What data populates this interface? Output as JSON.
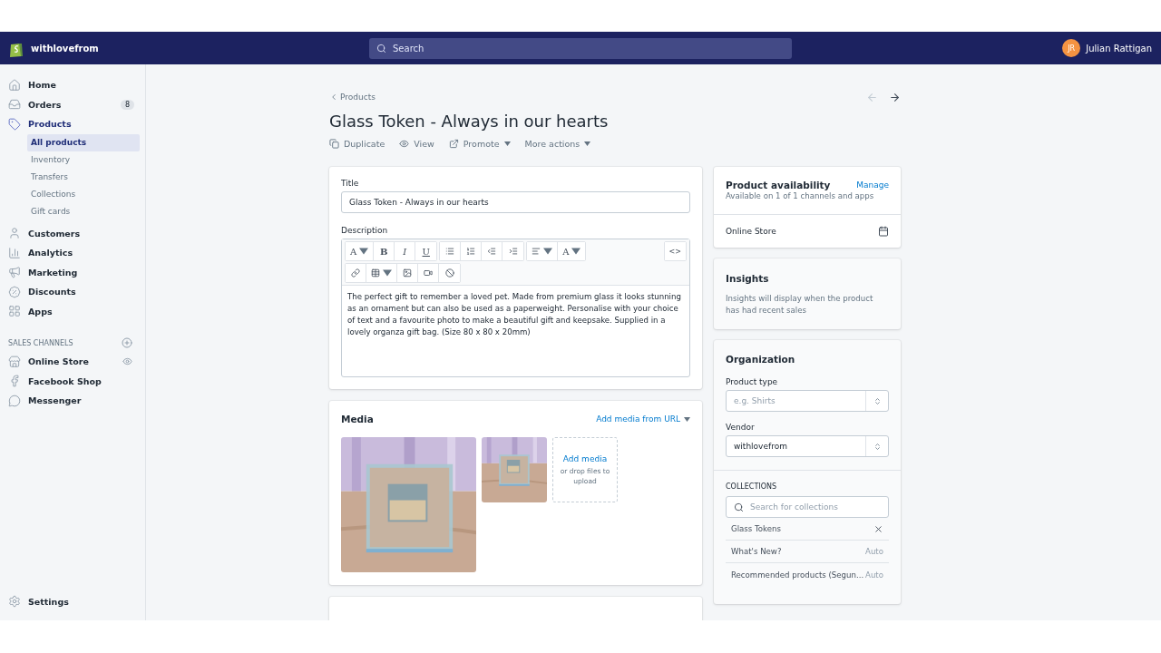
{
  "topbar": {
    "store_name": "withlovefrom",
    "search": {
      "placeholder": "Search"
    },
    "user": {
      "initials": "JR",
      "name": "Julian Rattigan"
    }
  },
  "sidebar": {
    "items": [
      {
        "label": "Home",
        "selected": false
      },
      {
        "label": "Orders",
        "selected": false,
        "badge": "8"
      },
      {
        "label": "Products",
        "selected": true,
        "children": [
          {
            "label": "All products",
            "selected": true
          },
          {
            "label": "Inventory",
            "selected": false
          },
          {
            "label": "Transfers",
            "selected": false
          },
          {
            "label": "Collections",
            "selected": false
          },
          {
            "label": "Gift cards",
            "selected": false
          }
        ]
      },
      {
        "label": "Customers",
        "selected": false
      },
      {
        "label": "Analytics",
        "selected": false
      },
      {
        "label": "Marketing",
        "selected": false
      },
      {
        "label": "Discounts",
        "selected": false
      },
      {
        "label": "Apps",
        "selected": false
      }
    ],
    "sales_channels": {
      "heading": "SALES CHANNELS",
      "items": [
        {
          "label": "Online Store"
        },
        {
          "label": "Facebook Shop"
        },
        {
          "label": "Messenger"
        }
      ]
    },
    "settings": "Settings"
  },
  "page": {
    "breadcrumb": "Products",
    "title": "Glass Token - Always in our hearts",
    "actions": [
      {
        "label": "Duplicate",
        "dropdown": false
      },
      {
        "label": "View",
        "dropdown": false
      },
      {
        "label": "Promote",
        "dropdown": true
      },
      {
        "label": "More actions",
        "dropdown": true
      }
    ]
  },
  "product": {
    "title_label": "Title",
    "title_value": "Glass Token - Always in our hearts",
    "description_label": "Description",
    "toolbar": {
      "font": "A",
      "bold": "B",
      "italic": "I",
      "underline": "U",
      "text_color": "A",
      "code": "<>"
    },
    "description": "The perfect gift to remember a loved pet. Made from premium glass it looks stunning as an ornament but can also be used as a paperweight. Personalise with your choice of text and a favourite photo to make a beautiful gift and keepsake. Supplied in a lovely organza gift bag. (Size 80 x 80 x 20mm)"
  },
  "media": {
    "heading": "Media",
    "add_from_url": "Add media from URL",
    "dropzone": {
      "title": "Add media",
      "hint": "or drop files to upload"
    }
  },
  "availability": {
    "heading": "Product availability",
    "manage": "Manage",
    "summary": "Available on 1 of 1 channels and apps",
    "channels": [
      {
        "name": "Online Store"
      }
    ]
  },
  "insights": {
    "heading": "Insights",
    "text": "Insights will display when the product has had recent sales"
  },
  "organization": {
    "heading": "Organization",
    "product_type": {
      "label": "Product type",
      "placeholder": "e.g. Shirts"
    },
    "vendor": {
      "label": "Vendor",
      "value": "withlovefrom"
    },
    "collections": {
      "heading": "COLLECTIONS",
      "search_placeholder": "Search for collections",
      "items": [
        {
          "name": "Glass Tokens",
          "kind": "manual"
        },
        {
          "name": "What's New?",
          "kind": "auto",
          "tag": "Auto"
        },
        {
          "name": "Recommended products (Segun...",
          "kind": "auto",
          "tag": "Auto"
        }
      ]
    }
  }
}
